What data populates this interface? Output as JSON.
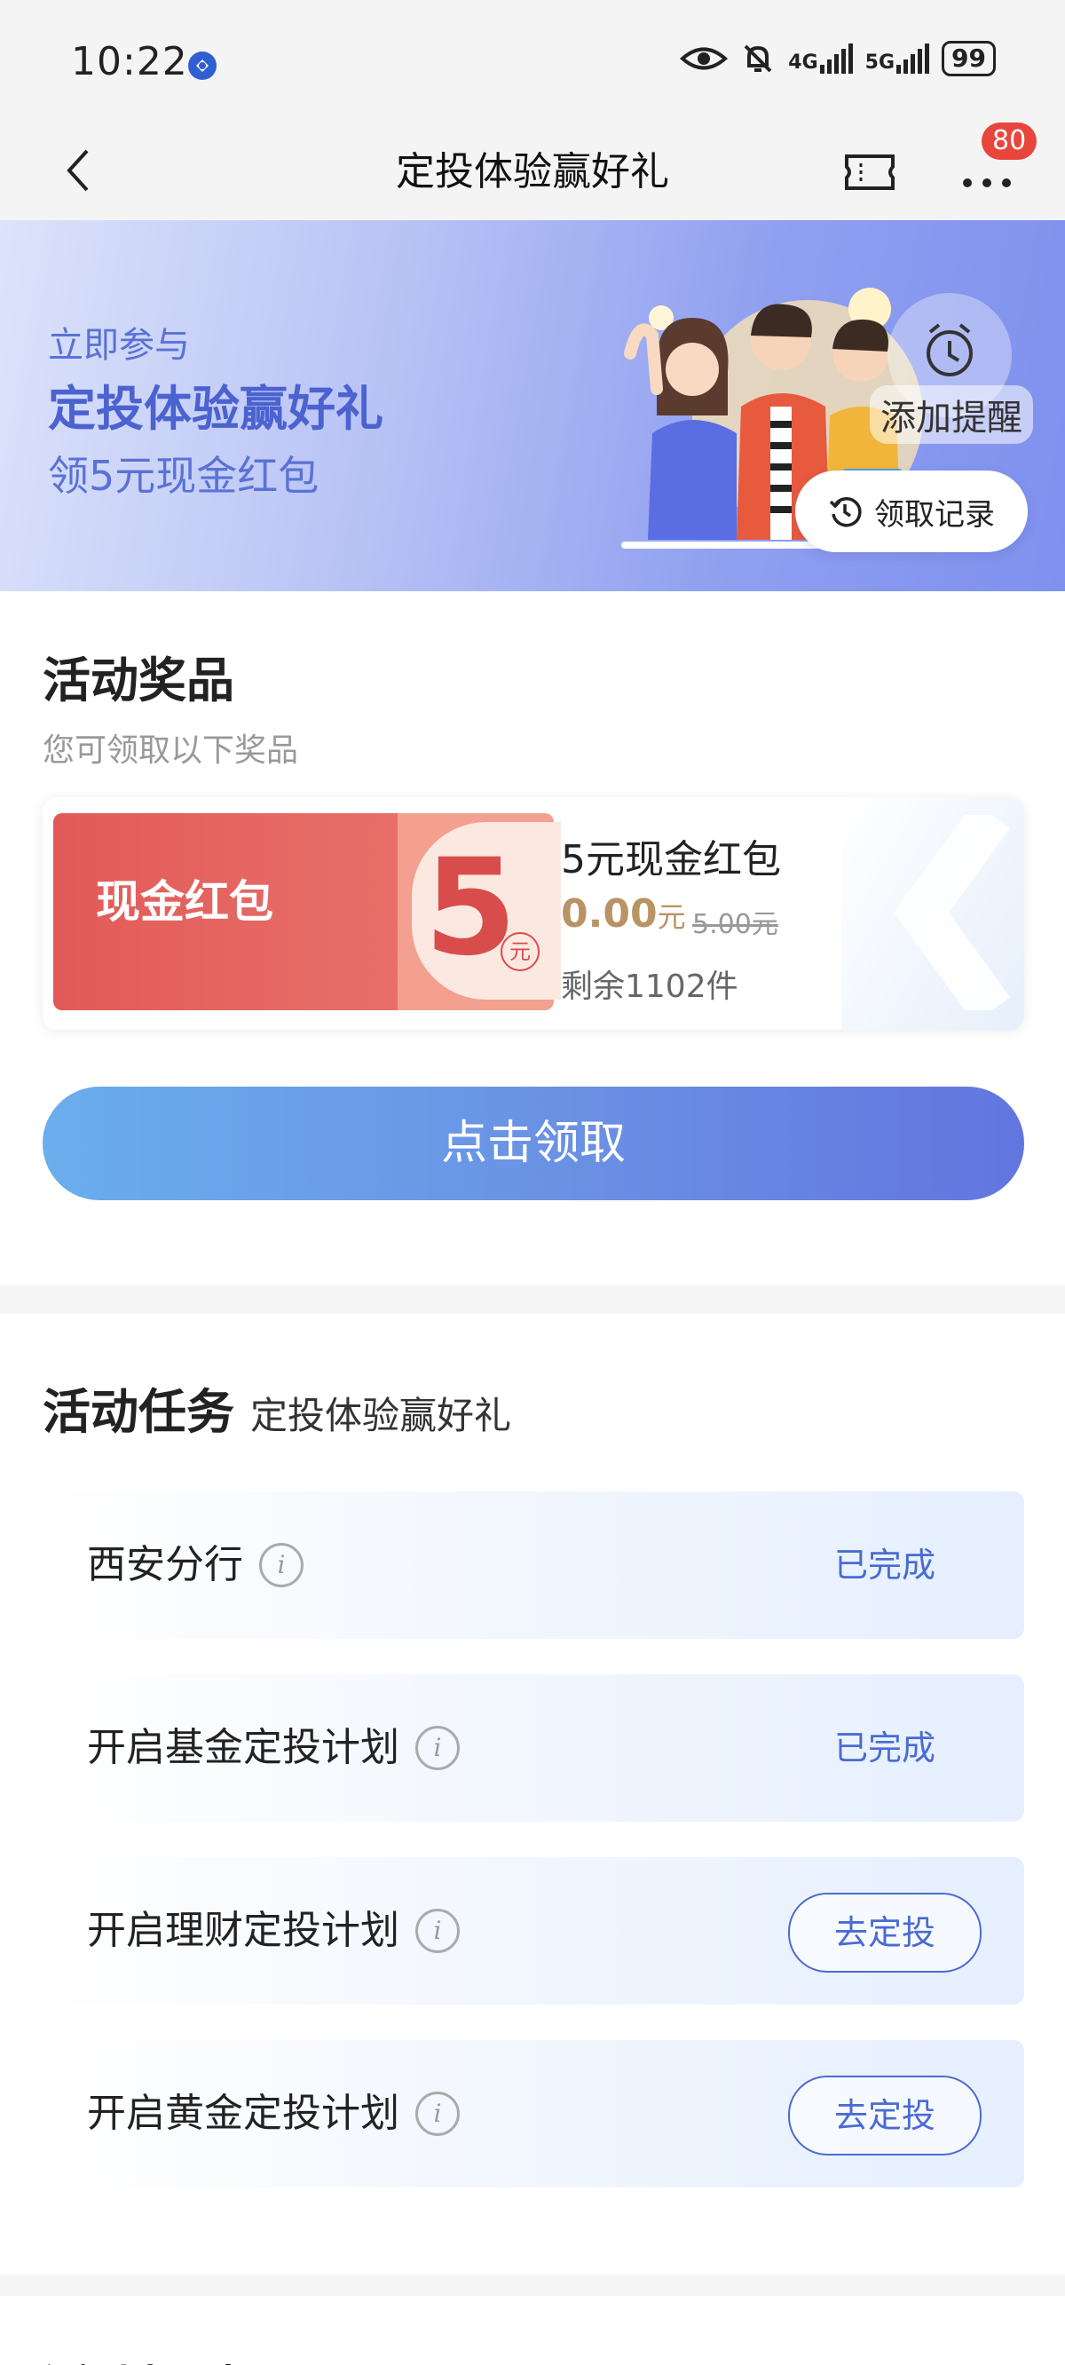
{
  "status_bar": {
    "time": "10:22",
    "net1": "4G",
    "net2": "5G",
    "battery": "99"
  },
  "nav": {
    "title": "定投体验赢好礼",
    "badge": "80"
  },
  "banner": {
    "line1": "立即参与",
    "line2": "定投体验赢好礼",
    "line3": "领5元现金红包",
    "remind_label": "添加提醒",
    "record_label": "领取记录"
  },
  "prizes": {
    "title": "活动奖品",
    "subtitle": "您可领取以下奖品",
    "coupon": {
      "left_text": "现金红包",
      "amount": "5",
      "unit": "元",
      "name": "5元现金红包",
      "price": "0.00",
      "price_unit": "元",
      "original_price": "5.00元",
      "remaining": "剩余1102件"
    },
    "claim_button": "点击领取"
  },
  "tasks": {
    "title": "活动任务",
    "subtitle": "定投体验赢好礼",
    "items": [
      {
        "label": "西安分行",
        "status": "已完成"
      },
      {
        "label": "开启基金定投计划",
        "status": "已完成"
      },
      {
        "label": "开启理财定投计划",
        "action": "去定投"
      },
      {
        "label": "开启黄金定投计划",
        "action": "去定投"
      }
    ]
  },
  "rules": {
    "title": "活动规则"
  }
}
